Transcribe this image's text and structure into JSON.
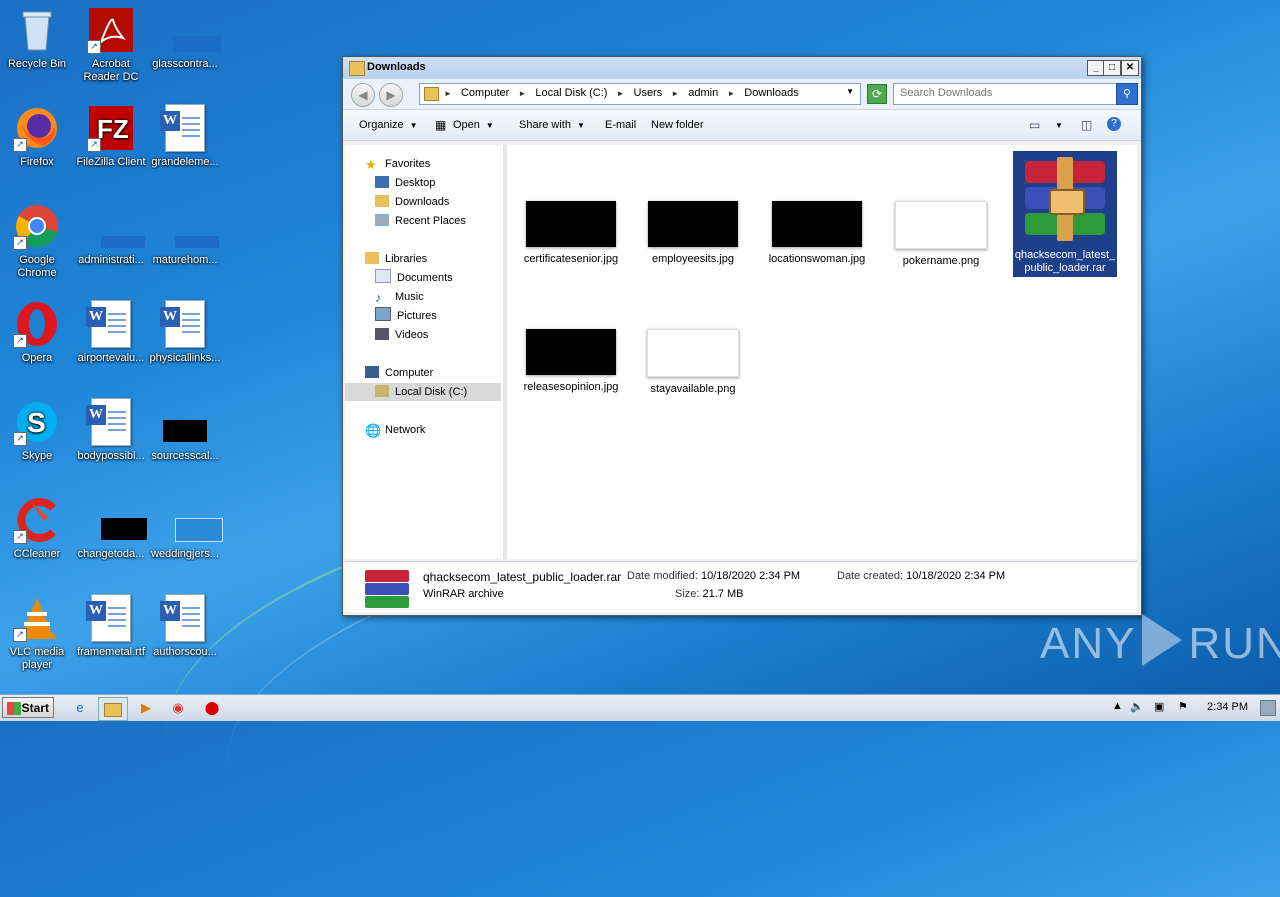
{
  "desktop": {
    "icons": [
      {
        "label": "Recycle Bin"
      },
      {
        "label": "Acrobat Reader DC"
      },
      {
        "label": "glasscontra..."
      },
      {
        "label": "Firefox"
      },
      {
        "label": "FileZilla Client"
      },
      {
        "label": "grandeleme..."
      },
      {
        "label": "Google Chrome"
      },
      {
        "label": "administrati..."
      },
      {
        "label": "maturehom..."
      },
      {
        "label": "Opera"
      },
      {
        "label": "airportevalu..."
      },
      {
        "label": "physicallinks..."
      },
      {
        "label": "Skype"
      },
      {
        "label": "bodypossibl..."
      },
      {
        "label": "sourcesscal..."
      },
      {
        "label": "CCleaner"
      },
      {
        "label": "changetoda..."
      },
      {
        "label": "weddingjers..."
      },
      {
        "label": "VLC media player"
      },
      {
        "label": "framemetal.rtf"
      },
      {
        "label": "authorscou..."
      }
    ]
  },
  "window": {
    "title": "Downloads",
    "breadcrumb": [
      "Computer",
      "Local Disk (C:)",
      "Users",
      "admin",
      "Downloads"
    ],
    "search_placeholder": "Search Downloads",
    "toolbar": {
      "organize": "Organize",
      "open": "Open",
      "share_with": "Share with",
      "email": "E-mail",
      "new_folder": "New folder"
    },
    "nav": {
      "favorites": "Favorites",
      "desktop": "Desktop",
      "downloads": "Downloads",
      "recent_places": "Recent Places",
      "libraries": "Libraries",
      "documents": "Documents",
      "music": "Music",
      "pictures": "Pictures",
      "videos": "Videos",
      "computer": "Computer",
      "local_disk": "Local Disk (C:)",
      "network": "Network"
    },
    "files": [
      {
        "name": "certificatesenior.jpg",
        "thumb": "black"
      },
      {
        "name": "employeesits.jpg",
        "thumb": "black"
      },
      {
        "name": "locationswoman.jpg",
        "thumb": "black"
      },
      {
        "name": "pokername.png",
        "thumb": "white"
      },
      {
        "name": "qhacksecom_latest_public_loader.rar",
        "thumb": "rar",
        "selected": true
      },
      {
        "name": "releasesopinion.jpg",
        "thumb": "black"
      },
      {
        "name": "stayavailable.png",
        "thumb": "white"
      }
    ],
    "status": {
      "filename": "qhacksecom_latest_public_loader.rar",
      "filetype": "WinRAR archive",
      "date_modified_label": "Date modified:",
      "date_modified": "10/18/2020 2:34 PM",
      "date_created_label": "Date created:",
      "date_created": "10/18/2020 2:34 PM",
      "size_label": "Size:",
      "size": "21.7 MB"
    }
  },
  "taskbar": {
    "start": "Start",
    "clock": "2:34 PM"
  },
  "watermark": {
    "left": "ANY",
    "right": "RUN"
  }
}
